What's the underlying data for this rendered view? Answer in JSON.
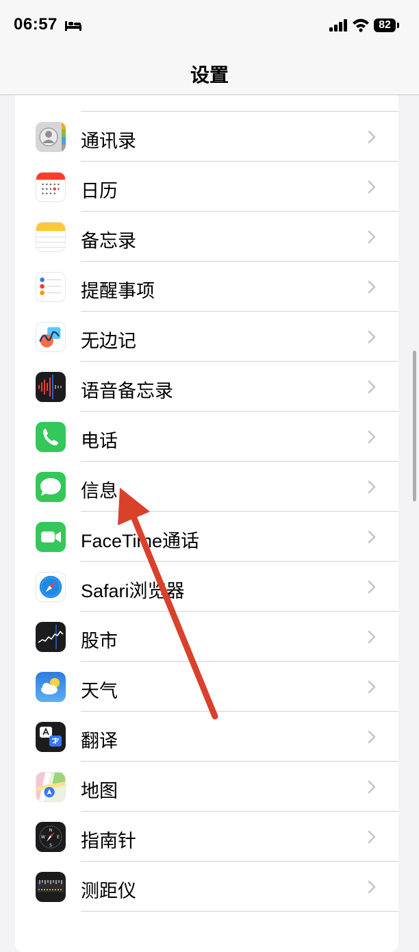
{
  "status_bar": {
    "time": "06:57",
    "battery": "82"
  },
  "nav": {
    "title": "设置"
  },
  "colors": {
    "annotation_arrow": "#d9412b",
    "separator": "#d1d1d6"
  },
  "rows": [
    {
      "label": "",
      "icon": "files-icon"
    },
    {
      "label": "通讯录",
      "icon": "contacts-icon"
    },
    {
      "label": "日历",
      "icon": "calendar-icon"
    },
    {
      "label": "备忘录",
      "icon": "notes-icon"
    },
    {
      "label": "提醒事项",
      "icon": "reminders-icon"
    },
    {
      "label": "无边记",
      "icon": "freeform-icon"
    },
    {
      "label": "语音备忘录",
      "icon": "voice-memos-icon"
    },
    {
      "label": "电话",
      "icon": "phone-icon"
    },
    {
      "label": "信息",
      "icon": "messages-icon"
    },
    {
      "label": "FaceTime通话",
      "icon": "facetime-icon"
    },
    {
      "label": "Safari浏览器",
      "icon": "safari-icon"
    },
    {
      "label": "股市",
      "icon": "stocks-icon"
    },
    {
      "label": "天气",
      "icon": "weather-icon"
    },
    {
      "label": "翻译",
      "icon": "translate-icon"
    },
    {
      "label": "地图",
      "icon": "maps-icon"
    },
    {
      "label": "指南针",
      "icon": "compass-icon"
    },
    {
      "label": "测距仪",
      "icon": "measure-icon"
    }
  ]
}
